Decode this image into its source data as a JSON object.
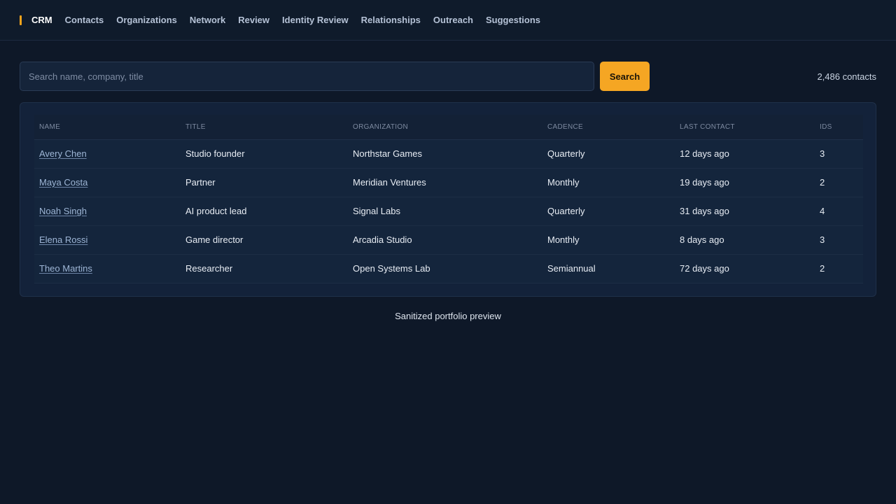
{
  "nav": {
    "brand": "CRM",
    "items": [
      "Contacts",
      "Organizations",
      "Network",
      "Review",
      "Identity Review",
      "Relationships",
      "Outreach",
      "Suggestions"
    ]
  },
  "search": {
    "placeholder": "Search name, company, title",
    "value": "",
    "button_label": "Search"
  },
  "contact_count": "2,486 contacts",
  "table": {
    "headers": [
      "NAME",
      "TITLE",
      "ORGANIZATION",
      "CADENCE",
      "LAST CONTACT",
      "IDS"
    ],
    "rows": [
      {
        "name": "Avery Chen",
        "title": "Studio founder",
        "organization": "Northstar Games",
        "cadence": "Quarterly",
        "last_contact": "12 days ago",
        "ids": "3"
      },
      {
        "name": "Maya Costa",
        "title": "Partner",
        "organization": "Meridian Ventures",
        "cadence": "Monthly",
        "last_contact": "19 days ago",
        "ids": "2"
      },
      {
        "name": "Noah Singh",
        "title": "AI product lead",
        "organization": "Signal Labs",
        "cadence": "Quarterly",
        "last_contact": "31 days ago",
        "ids": "4"
      },
      {
        "name": "Elena Rossi",
        "title": "Game director",
        "organization": "Arcadia Studio",
        "cadence": "Monthly",
        "last_contact": "8 days ago",
        "ids": "3"
      },
      {
        "name": "Theo Martins",
        "title": "Researcher",
        "organization": "Open Systems Lab",
        "cadence": "Semiannual",
        "last_contact": "72 days ago",
        "ids": "2"
      }
    ]
  },
  "footer_note": "Sanitized portfolio preview",
  "colors": {
    "accent": "#f5a623",
    "background": "#0e1828",
    "link": "#9eb6d6"
  }
}
